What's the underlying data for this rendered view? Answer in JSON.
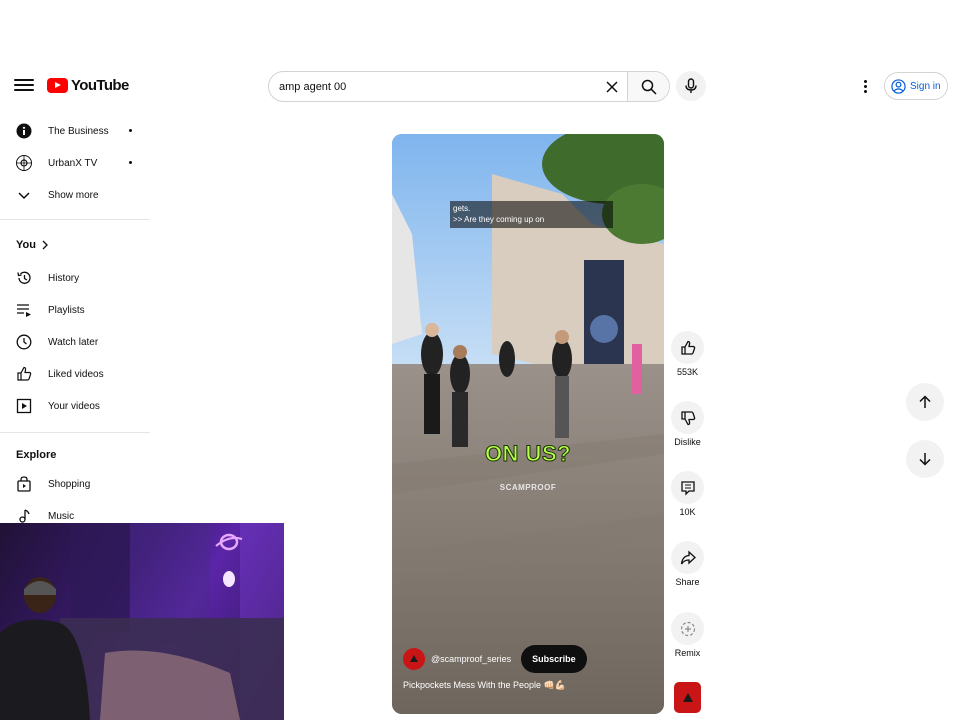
{
  "header": {
    "logo_text": "YouTube",
    "search": {
      "value": "amp agent 00",
      "placeholder": "Search"
    },
    "signin_label": "Sign in"
  },
  "sidebar": {
    "subscriptions": [
      {
        "label": "The Business",
        "icon": "info-icon"
      },
      {
        "label": "UrbanX TV",
        "icon": "channel-avatar-icon"
      }
    ],
    "show_more_label": "Show more",
    "you": {
      "heading": "You",
      "items": [
        {
          "label": "History",
          "icon": "history-icon"
        },
        {
          "label": "Playlists",
          "icon": "playlists-icon"
        },
        {
          "label": "Watch later",
          "icon": "clock-icon"
        },
        {
          "label": "Liked videos",
          "icon": "thumbs-up-icon"
        },
        {
          "label": "Your videos",
          "icon": "play-square-icon"
        }
      ]
    },
    "explore": {
      "heading": "Explore",
      "items": [
        {
          "label": "Shopping",
          "icon": "shopping-bag-icon"
        },
        {
          "label": "Music",
          "icon": "music-note-icon"
        }
      ]
    }
  },
  "short": {
    "caption_lines": [
      "gets.",
      ">> Are they coming up on"
    ],
    "overlay_text": "ON US?",
    "watermark": "SCAMPROOF",
    "channel": "@scamproof_series",
    "subscribe_label": "Subscribe",
    "title": "Pickpockets Mess With the People 👊🏻💪🏻"
  },
  "actions": {
    "like_count": "553K",
    "dislike_label": "Dislike",
    "comment_count": "10K",
    "share_label": "Share",
    "remix_label": "Remix"
  },
  "colors": {
    "brand_red": "#ff0000",
    "link_blue": "#065fd4",
    "overlay_green": "#b6ff4a"
  }
}
